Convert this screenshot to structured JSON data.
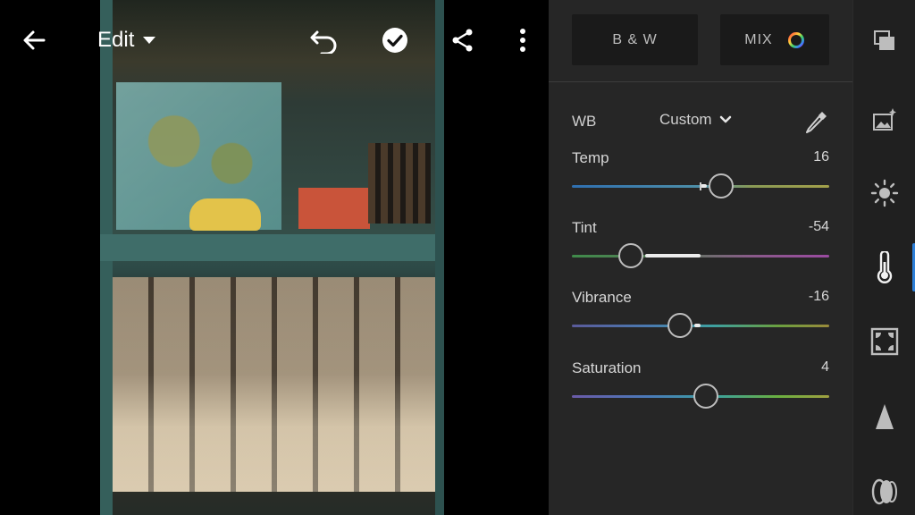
{
  "topbar": {
    "edit_label": "Edit"
  },
  "panel": {
    "bw_label": "B & W",
    "mix_label": "MIX",
    "wb_label": "WB",
    "wb_value": "Custom",
    "sliders": [
      {
        "name": "Temp",
        "value": "16",
        "fraction": 0.58,
        "track": "linear-gradient(90deg,#2f6fb0,#4e8fa8 50%,#8a9a55 70%,#a3a04a)"
      },
      {
        "name": "Tint",
        "value": "-54",
        "fraction": 0.23,
        "track": "linear-gradient(90deg,#3f8a4a,#5a7a5a 40%,#8a5a8a 70%,#9a4aa0)"
      },
      {
        "name": "Vibrance",
        "value": "-16",
        "fraction": 0.42,
        "track": "linear-gradient(90deg,#5a5a9a,#4a7ab0 30%,#3ea0a0 55%,#6aa040 80%,#9a8a3a)"
      },
      {
        "name": "Saturation",
        "value": "4",
        "fraction": 0.52,
        "track": "linear-gradient(90deg,#6a5aa8,#4a7ab8 30%,#3aa0a0 55%,#6ab040 80%,#a0a040)"
      }
    ]
  },
  "colors": {
    "panel_bg": "#262626",
    "rail_bg": "#202020",
    "accent": "#2d7fd8",
    "slider_highlight": "#ececec"
  },
  "rail": {
    "icons": [
      "presets-icon",
      "auto-enhance-icon",
      "light-icon",
      "color-thermometer-icon",
      "vignette-icon",
      "detail-icon",
      "optics-icon"
    ],
    "active": "color-thermometer-icon"
  }
}
